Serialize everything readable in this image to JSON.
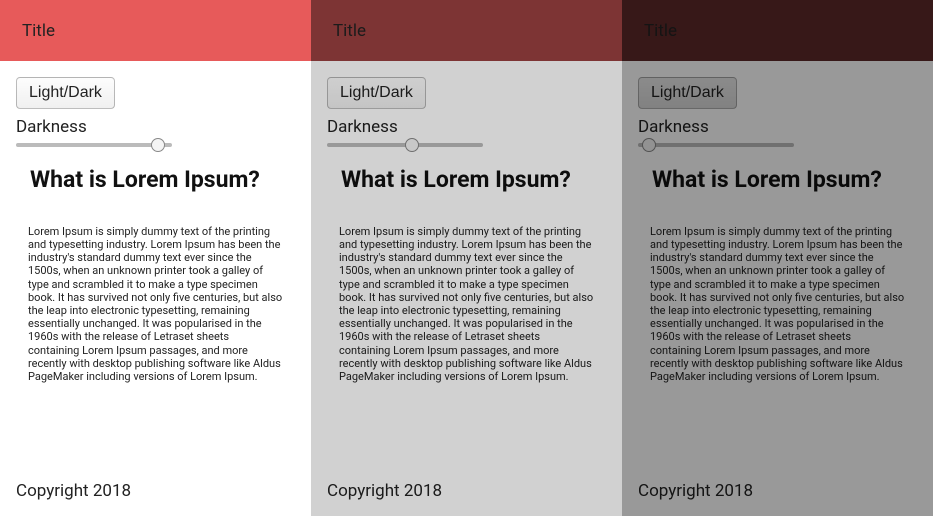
{
  "columns": [
    {
      "title": "Title",
      "button_label": "Light/Dark",
      "slider_label": "Darkness",
      "slider_value": 95,
      "heading": "What is Lorem Ipsum?",
      "body": "Lorem Ipsum is simply dummy text of the printing and typesetting industry. Lorem Ipsum has been the industry's standard dummy text ever since the 1500s, when an unknown printer took a galley of type and scrambled it to make a type specimen book. It has survived not only five centuries, but also the leap into electronic typesetting, remaining essentially unchanged. It was popularised in the 1960s with the release of Letraset sheets containing Lorem Ipsum passages, and more recently with desktop publishing software like Aldus PageMaker including versions of Lorem Ipsum.",
      "footer": "Copyright 2018"
    },
    {
      "title": "Title",
      "button_label": "Light/Dark",
      "slider_label": "Darkness",
      "slider_value": 55,
      "heading": "What is Lorem Ipsum?",
      "body": "Lorem Ipsum is simply dummy text of the printing and typesetting industry. Lorem Ipsum has been the industry's standard dummy text ever since the 1500s, when an unknown printer took a galley of type and scrambled it to make a type specimen book. It has survived not only five centuries, but also the leap into electronic typesetting, remaining essentially unchanged. It was popularised in the 1960s with the release of Letraset sheets containing Lorem Ipsum passages, and more recently with desktop publishing software like Aldus PageMaker including versions of Lorem Ipsum.",
      "footer": "Copyright 2018"
    },
    {
      "title": "Title",
      "button_label": "Light/Dark",
      "slider_label": "Darkness",
      "slider_value": 3,
      "heading": "What is Lorem Ipsum?",
      "body": "Lorem Ipsum is simply dummy text of the printing and typesetting industry. Lorem Ipsum has been the industry's standard dummy text ever since the 1500s, when an unknown printer took a galley of type and scrambled it to make a type specimen book. It has survived not only five centuries, but also the leap into electronic typesetting, remaining essentially unchanged. It was popularised in the 1960s with the release of Letraset sheets containing Lorem Ipsum passages, and more recently with desktop publishing software like Aldus PageMaker including versions of Lorem Ipsum.",
      "footer": "Copyright 2018"
    }
  ],
  "colors": {
    "header_light": "#e75a5a",
    "header_mid": "#994040",
    "header_dark": "#5c2828"
  }
}
